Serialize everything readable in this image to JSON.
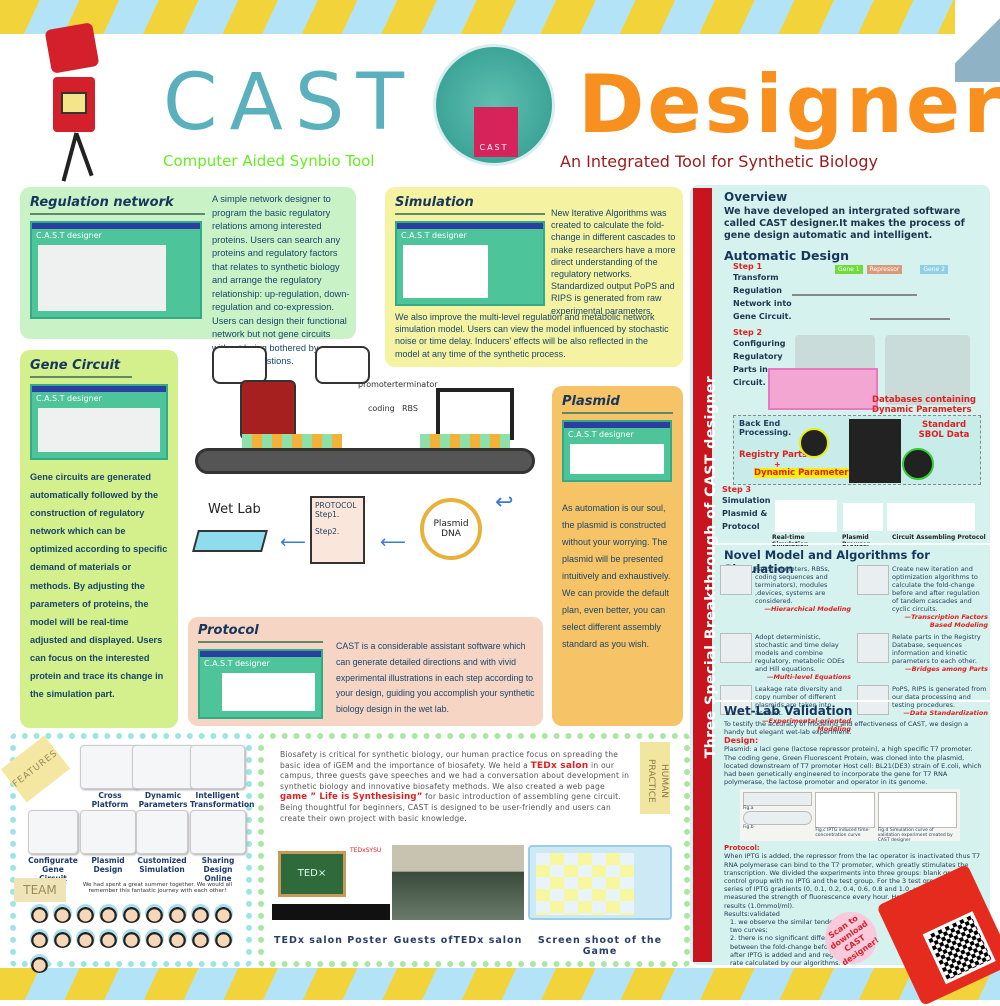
{
  "header": {
    "title_left": "CAST",
    "title_right": "Designer",
    "subtitle_left": "Computer Aided Synbio Tool",
    "subtitle_right": "An Integrated Tool for Synthetic Biology",
    "logo_text": "CAST"
  },
  "colors": {
    "teal": "#5bb0bd",
    "orange": "#f7901e",
    "green": "#66ee22",
    "darkred": "#9b1b1b",
    "accent_red": "#e02020"
  },
  "regulation": {
    "title": "Regulation network",
    "app": "C.A.S.T designer",
    "text": "A simple network designer to program the basic regulatory relations among interested proteins. Users can search any proteins and regulatory factors that relates to synthetic biology and arrange the regulatory relationship: up-regulation, down-regulation and co-expression. Users can design their functional network but not gene circuits without being bothered by technical questions."
  },
  "simulation": {
    "title": "Simulation",
    "app": "C.A.S.T designer",
    "text1": "New Iterative Algorithms was created to calculate the fold-change in different cascades to make researchers have a more direct understanding of the regulatory networks. Standardized output PoPS and RIPS is generated from raw experimental parameters.",
    "text2": "We also improve the multi-level regulation and metabolic network simulation model. Users can view the model influenced by stochastic noise or time delay. Inducers' effects will be also reflected in the model at any time of the synthetic process."
  },
  "gene_circuit": {
    "title": "Gene Circuit",
    "app": "C.A.S.T designer",
    "text": "Gene circuits are generated automatically followed by the construction of regulatory network which can be optimized according to specific demand of materials or methods. By adjusting the parameters of proteins, the model will be real-time adjusted and displayed. Users can focus on the interested protein and trace its change in the simulation part."
  },
  "plasmid": {
    "title": "Plasmid",
    "app": "C.A.S.T designer",
    "text": "As automation is our soul, the plasmid is constructed without your worrying. The plasmid will be presented intuitively and exhaustively. We can provide the default plan, even better, you can select different assembly standard as you wish."
  },
  "protocol": {
    "title": "Protocol",
    "app": "C.A.S.T designer",
    "text": "CAST is a considerable assistant software which can generate detailed directions and with vivid experimental illustrations in each step according to your design, guiding you accomplish your synthetic biology design in the wet lab."
  },
  "illustration": {
    "parts": [
      "promoter",
      "terminator",
      "coding",
      "RBS"
    ],
    "wet_lab": "Wet Lab",
    "protocol_title": "PROTOCOL",
    "steps": [
      "Step1.",
      "Step2."
    ],
    "plasmid_label": "Plasmid DNA"
  },
  "right_panel": {
    "vertical_title": "Three Special Breakthrough of CAST designer",
    "overview": {
      "title": "Overview",
      "text": "We have developed an intergrated software called CAST designer.It makes the process of gene design automatic and intelligent."
    },
    "automatic": {
      "title": "Automatic Design",
      "step1": "Step 1",
      "step1_text": "Transform Regulation Network into Gene Circuit.",
      "genes": [
        "Gene 1",
        "Repressor",
        "Gene 2"
      ],
      "step2": "Step 2",
      "step2_text": "Configuring Regulatory Parts in Circuit.",
      "db_label": "Databases containing Dynamic Parameters",
      "backend": "Back End Processing.",
      "registry": "Registry Parts",
      "plus": "+",
      "dynamic": "Dynamic Parameters",
      "sbol": "Standard SBOL Data",
      "step3": "Step 3",
      "step3_text": "Simulation Plasmid & Protocol",
      "outputs": [
        "Real-time Simulation",
        "Plasmid Browser",
        "Circuit Assembling Protocol"
      ]
    },
    "novel": {
      "title": "Novel Model and Algorithms for Simulation",
      "items": [
        {
          "text": "Parts(promoters, RBSs, coding sequences and terminators), modules ,devices, systems are considered.",
          "tag": "—Hierarchical Modeling"
        },
        {
          "text": "Create new iteration and optimization algorithms to calculate the fold-change before and after regulation of tandem cascades and cyclic circuits.",
          "tag": "—Transcription Factors Based Modeling"
        },
        {
          "text": "Adopt deterministic, stochastic and time delay models and combine regulatory, metabolic ODEs and Hill equations.",
          "tag": "—Multi-level Equations"
        },
        {
          "text": "Relate parts in the Registry Database, sequences information and kinetic parameters to each other.",
          "tag": "—Bridges among Parts"
        },
        {
          "text": "Leakage rate diversity and copy number of different plasmids are taken into account.",
          "tag": "—Experimental-oriented Modeling"
        },
        {
          "text": "PoPS, RIPS is generated from our data processing and testing procedures.",
          "tag": "—Data Standardization"
        }
      ]
    },
    "wetlab": {
      "title": "Wet-Lab Validation",
      "intro": "To testify the accuracy of modeling and effectiveness of CAST, we design a handy but elegant wet-lab experiment.",
      "design_label": "Design:",
      "design": "Plasmid: a lacI gene (lactose repressor protein), a high specific T7 promoter. The coding gene, Green Fluorescent Protein, was cloned into the plasmid, located downstream of T7 promoter Host cell: BL21(DE3) strain of E.coli, which had been genetically engineered to incorporate the gene for T7 RNA polymerase, the lactose promoter and operator in its genome.",
      "figs": [
        "Fig.a",
        "Fig.b",
        "Fig.c IPTG induced time-concentration curve",
        "Fig.d Simulation curve of validation experiment created by CAST designer"
      ],
      "protocol_label": "Protocol:",
      "protocol": "When IPTG is added, the repressor from the lac operator is inactivated thus T7 RNA polymerase can bind to the T7 promoter, which greatly stimulates the transcription. We divided the experiments into three groups: blank group, control group with no IPTG and the test group. For the 3 test group, we set a series of IPTG gradients (0, 0.1, 0.2, 0.4, 0.6, 0.8 and 1.0, unit: mmol/ml) and measured the strength of fluorescence every hour. Here shows one of our results (1.0mmol/ml).",
      "results_label": "Results:validated",
      "results": [
        "1. we observe the similar tendency in two curves;",
        "2. there is no significant differences between the fold-change before and after IPTG is added and and regulation rate calculated by our algorithms."
      ],
      "scan": "Scan to download CAST designer!"
    }
  },
  "features": {
    "tag": "FEATURES",
    "items": [
      "Cross Platform",
      "Dynamic Parameters Database",
      "Intelligent Transformation",
      "Configurate Gene Circuit",
      "Plasmid Design",
      "Customized Simulation",
      "Sharing Design Online"
    ]
  },
  "team": {
    "tag": "TEAM",
    "text": "We had spent a great summer together. We would all remember this fantastic journey with each other!",
    "members": 19
  },
  "human_practice": {
    "tag": "HUMAN PRACTICE",
    "text_a": "Biosafety is critical for synthetic biology, our human practice focus on spreading the basic idea of iGEM and the importance of biosafety. We held a ",
    "hl1": "TEDx salon",
    "text_b": " in our campus, three guests gave speeches and we had a conversation about development in synthetic biology and innovative biosafety methods. We also created a web page ",
    "hl2": "game ” Life is Synthesising”",
    "text_c": " for basic introduction of assembling gene circuit. Being thoughtful for beginners, CAST is designed to be user-friendly and users can create their own project with basic knowledge.",
    "captions": [
      "TEDx salon Poster",
      "Guests ofTEDx salon",
      "Screen shoot of the Game"
    ],
    "poster_text": "TED×",
    "poster_org": "TEDxSYSU"
  }
}
